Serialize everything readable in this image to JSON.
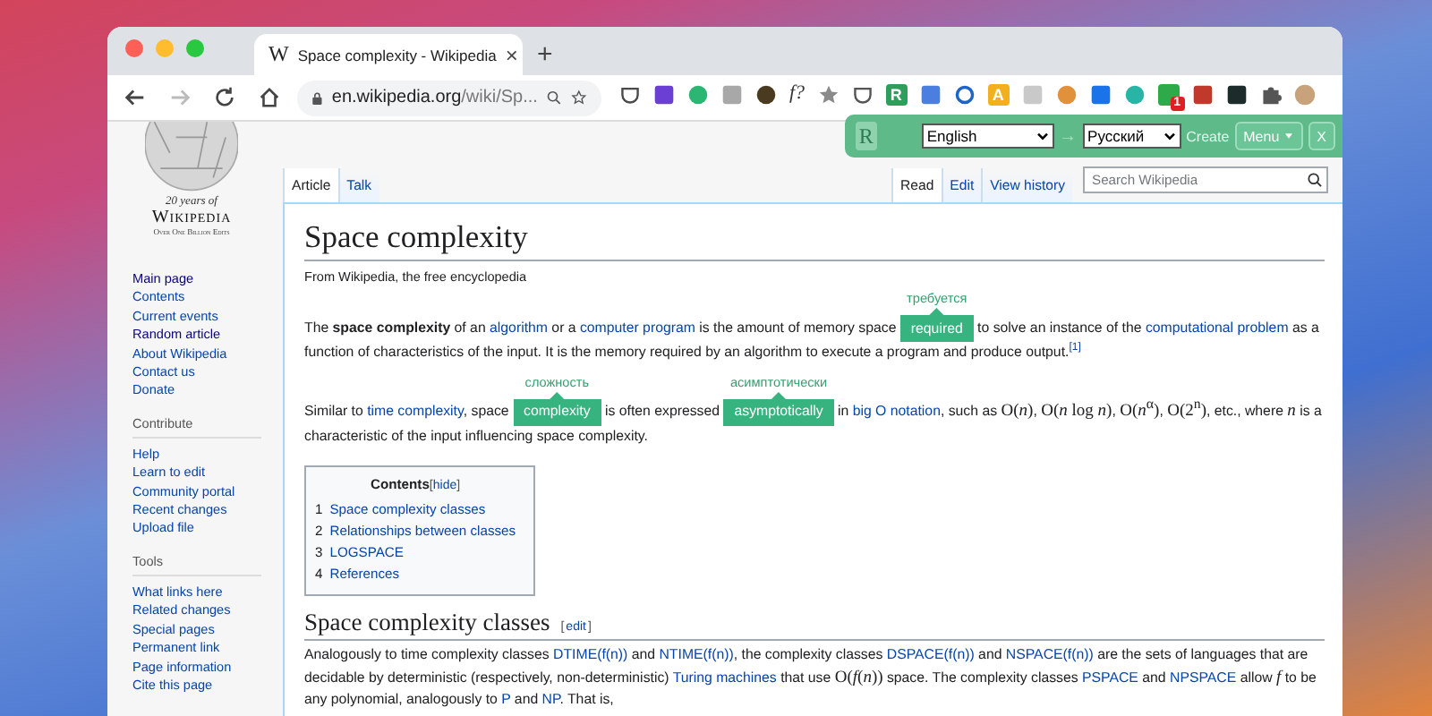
{
  "browser": {
    "tab": {
      "favicon": "W",
      "title": "Space complexity - Wikipedia",
      "close": "×"
    },
    "new_tab": "+",
    "url": {
      "host": "en.wikipedia.org",
      "path": "/wiki/Sp..."
    },
    "extensions": [
      {
        "kind": "outline",
        "color": "#4a4a4a"
      },
      {
        "kind": "square",
        "color": "#6b3fd4"
      },
      {
        "kind": "circle",
        "color": "#2bb673"
      },
      {
        "kind": "square",
        "color": "#a8a8a8"
      },
      {
        "kind": "circle",
        "color": "#4a3a20"
      },
      {
        "kind": "glyph",
        "color": "#333333",
        "text": "f?"
      },
      {
        "kind": "star",
        "color": "#8a8a8a"
      },
      {
        "kind": "outline",
        "color": "#555555"
      },
      {
        "kind": "square",
        "color": "#2e9e5b",
        "text": "R"
      },
      {
        "kind": "square",
        "color": "#4a7fe0"
      },
      {
        "kind": "ring",
        "color": "#1e63c6"
      },
      {
        "kind": "square",
        "color": "#f2b01e",
        "text": "A"
      },
      {
        "kind": "square",
        "color": "#c9c9c9"
      },
      {
        "kind": "circle",
        "color": "#e0913a"
      },
      {
        "kind": "square",
        "color": "#1a73e8"
      },
      {
        "kind": "circle",
        "color": "#29b5a5"
      },
      {
        "kind": "square",
        "color": "#2eaa4b",
        "badge": "1"
      },
      {
        "kind": "square",
        "color": "#c0392b"
      },
      {
        "kind": "square",
        "color": "#1d2b2b"
      },
      {
        "kind": "puzzle",
        "color": "#555555"
      },
      {
        "kind": "avatar",
        "color": "#c8a27a"
      }
    ]
  },
  "translator": {
    "logo": "R",
    "from": "English",
    "arrow": "→",
    "to": "Русский",
    "create": "Create",
    "menu": "Menu",
    "close": "X"
  },
  "sidebar": {
    "logo": {
      "tagline": "20 years of",
      "name": "Wikipedia",
      "subtitle": "Over One Billion Edits"
    },
    "nav": [
      {
        "label": "Main page",
        "visited": true
      },
      {
        "label": "Contents",
        "visited": false
      },
      {
        "label": "Current events",
        "visited": false
      },
      {
        "label": "Random article",
        "visited": true
      },
      {
        "label": "About Wikipedia",
        "visited": false
      },
      {
        "label": "Contact us",
        "visited": false
      },
      {
        "label": "Donate",
        "visited": false
      }
    ],
    "sections": [
      {
        "heading": "Contribute",
        "items": [
          {
            "label": "Help",
            "visited": false
          },
          {
            "label": "Learn to edit",
            "visited": false
          },
          {
            "label": "Community portal",
            "visited": false
          },
          {
            "label": "Recent changes",
            "visited": false
          },
          {
            "label": "Upload file",
            "visited": false
          }
        ]
      },
      {
        "heading": "Tools",
        "items": [
          {
            "label": "What links here",
            "visited": false
          },
          {
            "label": "Related changes",
            "visited": false
          },
          {
            "label": "Special pages",
            "visited": false
          },
          {
            "label": "Permanent link",
            "visited": false
          },
          {
            "label": "Page information",
            "visited": false
          },
          {
            "label": "Cite this page",
            "visited": false
          }
        ]
      }
    ]
  },
  "page_tabs": {
    "left": [
      {
        "label": "Article",
        "selected": true
      },
      {
        "label": "Talk",
        "selected": false
      }
    ],
    "right": [
      {
        "label": "Read",
        "selected": true
      },
      {
        "label": "Edit",
        "selected": false
      },
      {
        "label": "View history",
        "selected": false
      }
    ]
  },
  "search": {
    "placeholder": "Search Wikipedia"
  },
  "article": {
    "title": "Space complexity",
    "tagline": "From Wikipedia, the free encyclopedia",
    "paragraphs": [
      [
        {
          "kind": "text",
          "text": "The **space complexity** of an "
        },
        {
          "kind": "link",
          "text": "algorithm"
        },
        {
          "kind": "text",
          "text": " or a "
        },
        {
          "kind": "link",
          "text": "computer program"
        },
        {
          "kind": "text",
          "text": " is the amount of memory space "
        },
        {
          "kind": "highlight",
          "text": "required",
          "hint": "требуется"
        },
        {
          "kind": "text",
          "text": " to solve an instance of the "
        },
        {
          "kind": "link",
          "text": "computational problem"
        },
        {
          "kind": "text",
          "text": " as a function of characteristics of the input. It is the memory required by an algorithm to execute a program and produce output."
        },
        {
          "kind": "ref",
          "text": "[1]"
        }
      ],
      [
        {
          "kind": "text",
          "text": "Similar to "
        },
        {
          "kind": "link",
          "text": "time complexity"
        },
        {
          "kind": "text",
          "text": ", space "
        },
        {
          "kind": "highlight",
          "text": "complexity",
          "hint": "сложность"
        },
        {
          "kind": "text",
          "text": " is often expressed "
        },
        {
          "kind": "highlight",
          "text": "asymptotically",
          "hint": "асимптотически"
        },
        {
          "kind": "text",
          "text": " in "
        },
        {
          "kind": "link",
          "text": "big O notation"
        },
        {
          "kind": "text",
          "text": ", such as "
        },
        {
          "kind": "math",
          "text": "O(*n*)"
        },
        {
          "kind": "text",
          "text": ", "
        },
        {
          "kind": "math",
          "text": "O(*n* log *n*)"
        },
        {
          "kind": "text",
          "text": ", "
        },
        {
          "kind": "math",
          "text": "O(*n*$^{α}$)"
        },
        {
          "kind": "text",
          "text": ", "
        },
        {
          "kind": "math",
          "text": "O(2$^{n}$)"
        },
        {
          "kind": "text",
          "text": ", etc., where "
        },
        {
          "kind": "math",
          "text": "*n*"
        },
        {
          "kind": "text",
          "text": " is a characteristic of the input influencing space complexity."
        }
      ]
    ],
    "toc": {
      "title": "Contents",
      "toggle": {
        "before": "[",
        "label": "hide",
        "after": "]"
      },
      "items": [
        {
          "number": "1",
          "label": "Space complexity classes"
        },
        {
          "number": "2",
          "label": "Relationships between classes"
        },
        {
          "number": "3",
          "label": "LOGSPACE"
        },
        {
          "number": "4",
          "label": "References"
        }
      ]
    },
    "section": {
      "title": "Space complexity classes",
      "edit": {
        "before": "[",
        "label": "edit",
        "after": "]"
      },
      "paragraphs": [
        [
          {
            "kind": "text",
            "text": "Analogously to time complexity classes "
          },
          {
            "kind": "link",
            "text": "DTIME(f(n))"
          },
          {
            "kind": "text",
            "text": " and "
          },
          {
            "kind": "link",
            "text": "NTIME(f(n))"
          },
          {
            "kind": "text",
            "text": ", the complexity classes "
          },
          {
            "kind": "link",
            "text": "DSPACE(f(n))"
          },
          {
            "kind": "text",
            "text": " and "
          },
          {
            "kind": "link",
            "text": "NSPACE(f(n))"
          },
          {
            "kind": "text",
            "text": " are the sets of languages that are decidable by deterministic (respectively, non-deterministic) "
          },
          {
            "kind": "link",
            "text": "Turing machines"
          },
          {
            "kind": "text",
            "text": " that use "
          },
          {
            "kind": "math",
            "text": "O(*f*(*n*))"
          },
          {
            "kind": "text",
            "text": " space. The complexity classes "
          },
          {
            "kind": "link",
            "text": "PSPACE"
          },
          {
            "kind": "text",
            "text": " and "
          },
          {
            "kind": "link",
            "text": "NPSPACE"
          },
          {
            "kind": "text",
            "text": " allow "
          },
          {
            "kind": "math",
            "text": "*f*"
          },
          {
            "kind": "text",
            "text": " to be any polynomial, analogously to "
          },
          {
            "kind": "link",
            "text": "P"
          },
          {
            "kind": "text",
            "text": " and "
          },
          {
            "kind": "link",
            "text": "NP"
          },
          {
            "kind": "text",
            "text": ". That is,"
          }
        ]
      ]
    }
  }
}
